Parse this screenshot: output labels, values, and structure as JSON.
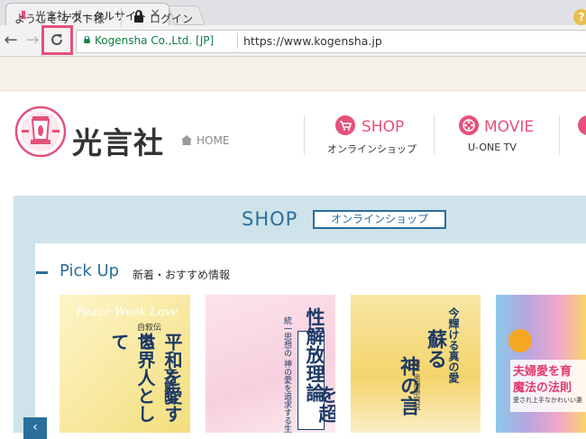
{
  "browser": {
    "tab_title": "光言社 ポータルサイト",
    "close_glyph": "×",
    "back_glyph": "←",
    "forward_glyph": "→",
    "reload_glyph": "C",
    "site_identity": "Kogensha Co.,Ltd. [JP]",
    "url": "https://www.kogensha.jp",
    "highlight_color": "#e4517a"
  },
  "sitebar": {
    "welcome": "ようこそ ゲスト様",
    "login": "ログイン",
    "help_glyph": "?"
  },
  "header": {
    "logo_text": "光言社",
    "home_link": "HOME",
    "nav": [
      {
        "label": "SHOP",
        "sublabel": "オンラインショップ",
        "icon": "cart-icon"
      },
      {
        "label": "MOVIE",
        "sublabel": "U-ONE TV",
        "icon": "film-reel-icon"
      }
    ],
    "brand_color": "#e4517a"
  },
  "shop": {
    "title": "SHOP",
    "badge": "オンラインショップ",
    "pickup_title": "Pick Up",
    "pickup_subtitle": "新着・おすすめ情報",
    "prev_glyph": "‹",
    "accent_color": "#2a6e9b"
  },
  "books": [
    {
      "top_text": "Peace Week Love",
      "series": "自叙伝",
      "title_lines": [
        "平和を愛する",
        "世界人として"
      ],
      "author": "文鮮明"
    },
    {
      "title_lines": [
        "性解放理論",
        "を超"
      ],
      "caption": "統一思想の 神の愛を追求する生"
    },
    {
      "header": "今輝ける真の愛",
      "title_lines": [
        "蘇る",
        "神の言"
      ],
      "caption": "統一思想研究院"
    },
    {
      "title_lines": [
        "夫婦愛を育",
        "魔法の法則"
      ],
      "caption": "愛され上手なかわいい妻"
    }
  ]
}
